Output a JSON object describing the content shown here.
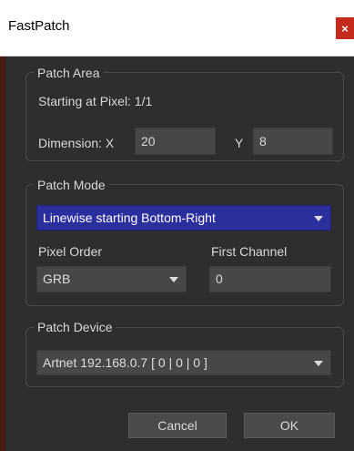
{
  "window": {
    "title": "FastPatch",
    "close_glyph": "×"
  },
  "patch_area": {
    "legend": "Patch Area",
    "starting_text": "Starting at Pixel: 1/1",
    "dimension_label": "Dimension: X",
    "x_value": "20",
    "y_label": "Y",
    "y_value": "8"
  },
  "patch_mode": {
    "legend": "Patch Mode",
    "mode_selected": "Linewise starting Bottom-Right",
    "pixel_order_label": "Pixel Order",
    "pixel_order_selected": "GRB",
    "first_channel_label": "First Channel",
    "first_channel_value": "0"
  },
  "patch_device": {
    "legend": "Patch Device",
    "device_selected": "Artnet 192.168.0.7 [ 0 | 0 | 0 ]"
  },
  "buttons": {
    "cancel": "Cancel",
    "ok": "OK"
  },
  "colors": {
    "background": "#2e2e2e",
    "input": "#474747",
    "accent_dropdown": "#2b2f9e",
    "close": "#c42b1c"
  }
}
